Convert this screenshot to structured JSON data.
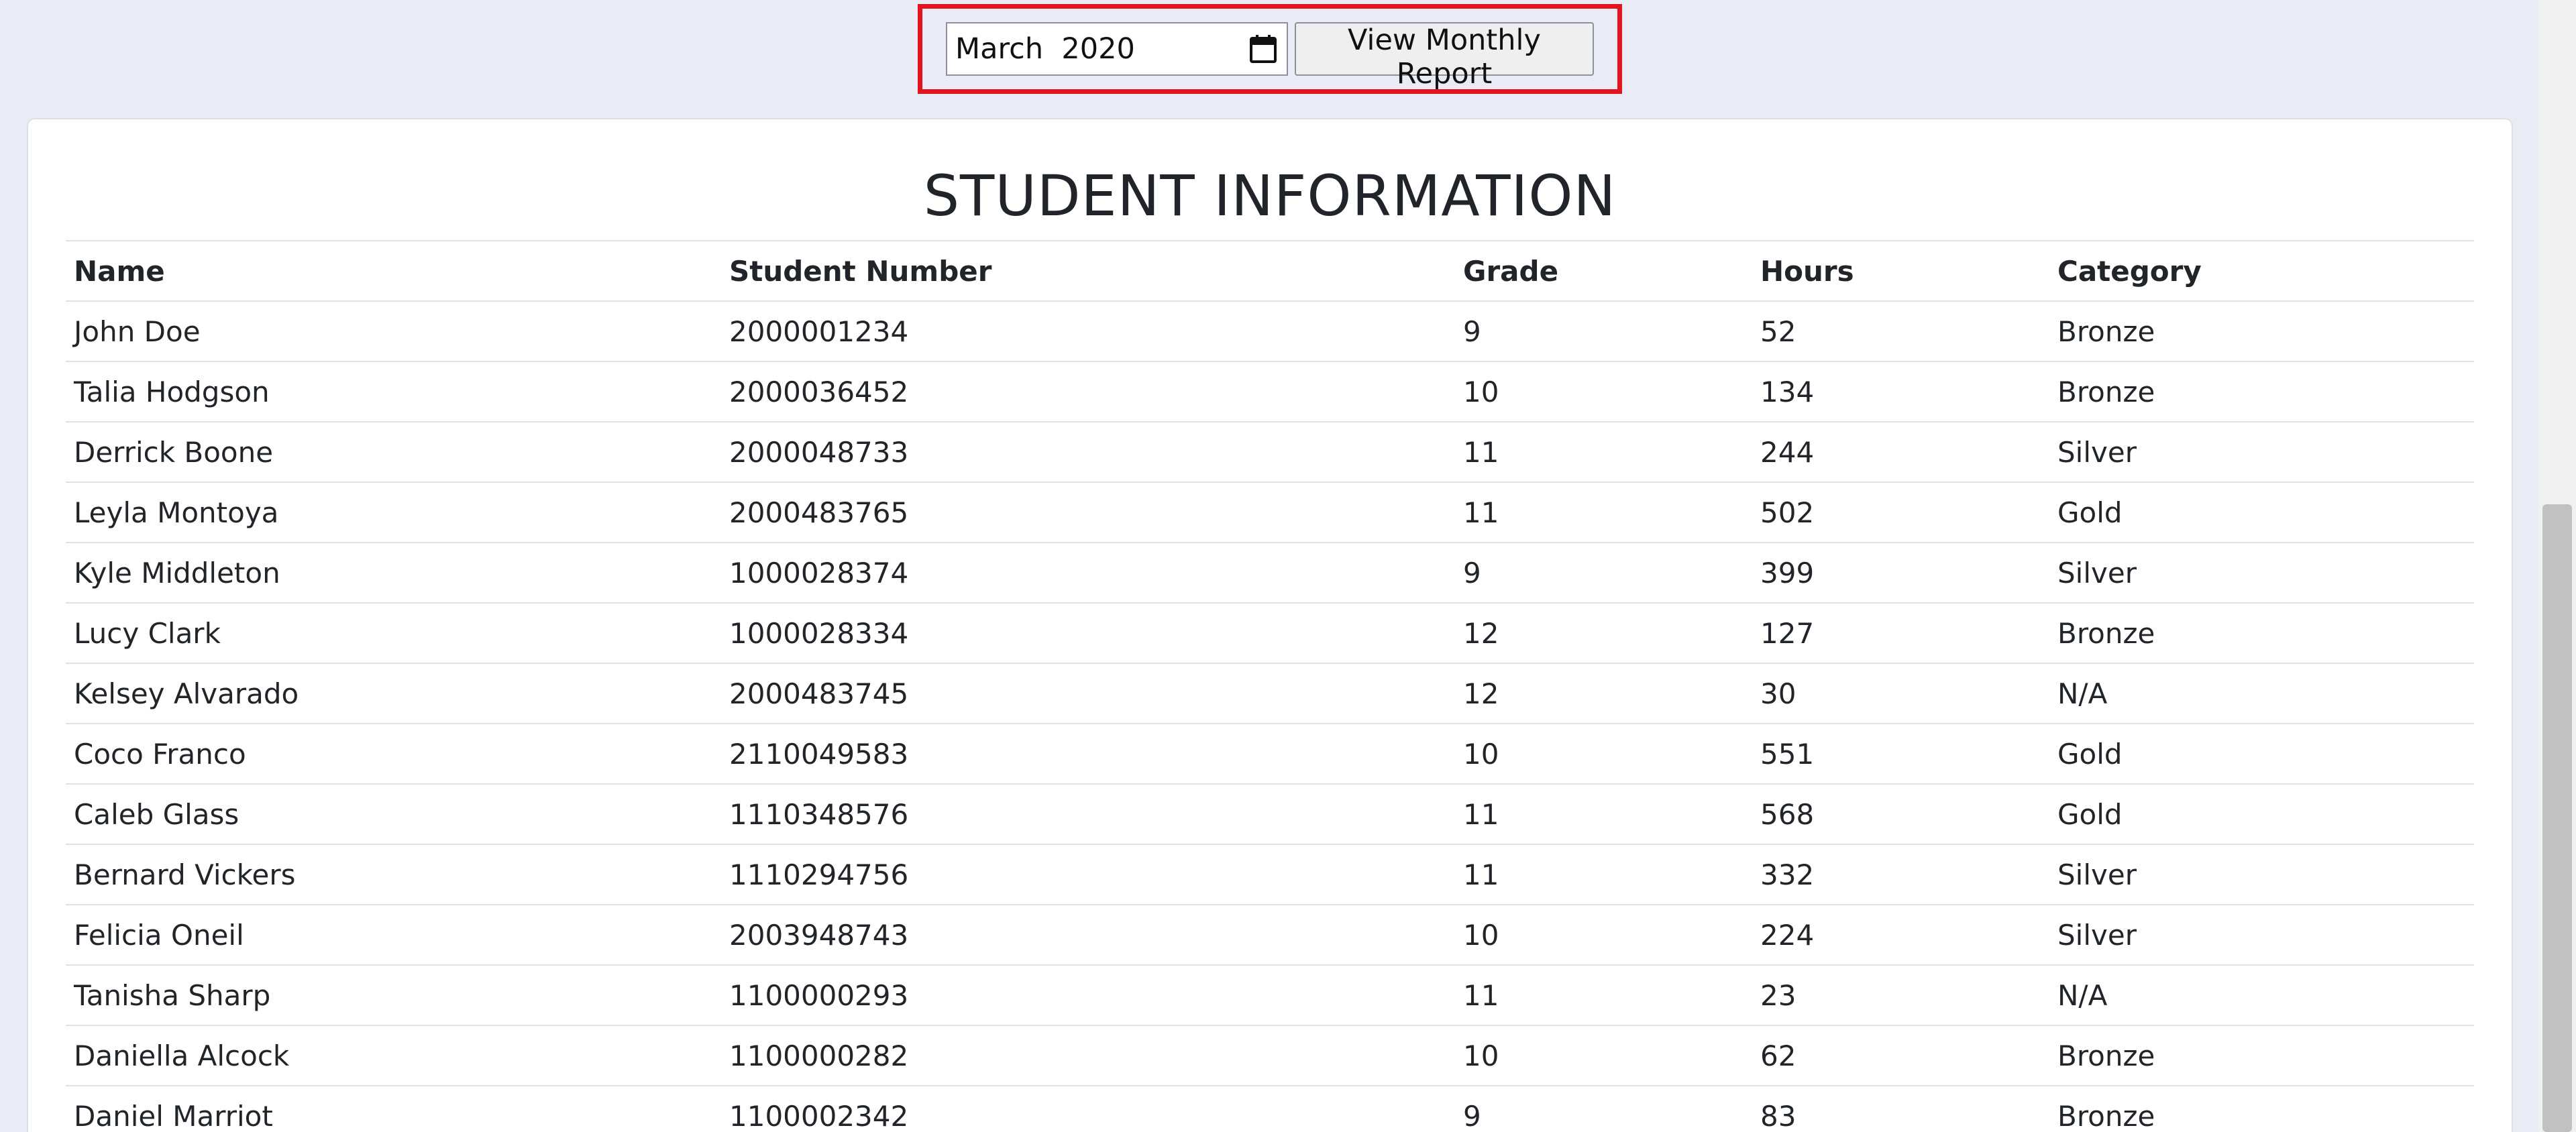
{
  "report_controls": {
    "month_value": "March  2020",
    "view_button_label": "View Monthly Report",
    "highlight_color": "#e2141e"
  },
  "student_table": {
    "title": "STUDENT INFORMATION",
    "headers": [
      "Name",
      "Student Number",
      "Grade",
      "Hours",
      "Category"
    ],
    "rows": [
      [
        "John Doe",
        "2000001234",
        "9",
        "52",
        "Bronze"
      ],
      [
        "Talia Hodgson",
        "2000036452",
        "10",
        "134",
        "Bronze"
      ],
      [
        "Derrick Boone",
        "2000048733",
        "11",
        "244",
        "Silver"
      ],
      [
        "Leyla Montoya",
        "2000483765",
        "11",
        "502",
        "Gold"
      ],
      [
        "Kyle Middleton",
        "1000028374",
        "9",
        "399",
        "Silver"
      ],
      [
        "Lucy Clark",
        "1000028334",
        "12",
        "127",
        "Bronze"
      ],
      [
        "Kelsey Alvarado",
        "2000483745",
        "12",
        "30",
        "N/A"
      ],
      [
        "Coco Franco",
        "2110049583",
        "10",
        "551",
        "Gold"
      ],
      [
        "Caleb Glass",
        "1110348576",
        "11",
        "568",
        "Gold"
      ],
      [
        "Bernard Vickers",
        "1110294756",
        "11",
        "332",
        "Silver"
      ],
      [
        "Felicia Oneil",
        "2003948743",
        "10",
        "224",
        "Silver"
      ],
      [
        "Tanisha Sharp",
        "1100000293",
        "11",
        "23",
        "N/A"
      ],
      [
        "Daniella Alcock",
        "1100000282",
        "10",
        "62",
        "Bronze"
      ],
      [
        "Daniel Marriot",
        "1100002342",
        "9",
        "83",
        "Bronze"
      ]
    ]
  },
  "icons": {
    "calendar": "calendar-icon"
  }
}
